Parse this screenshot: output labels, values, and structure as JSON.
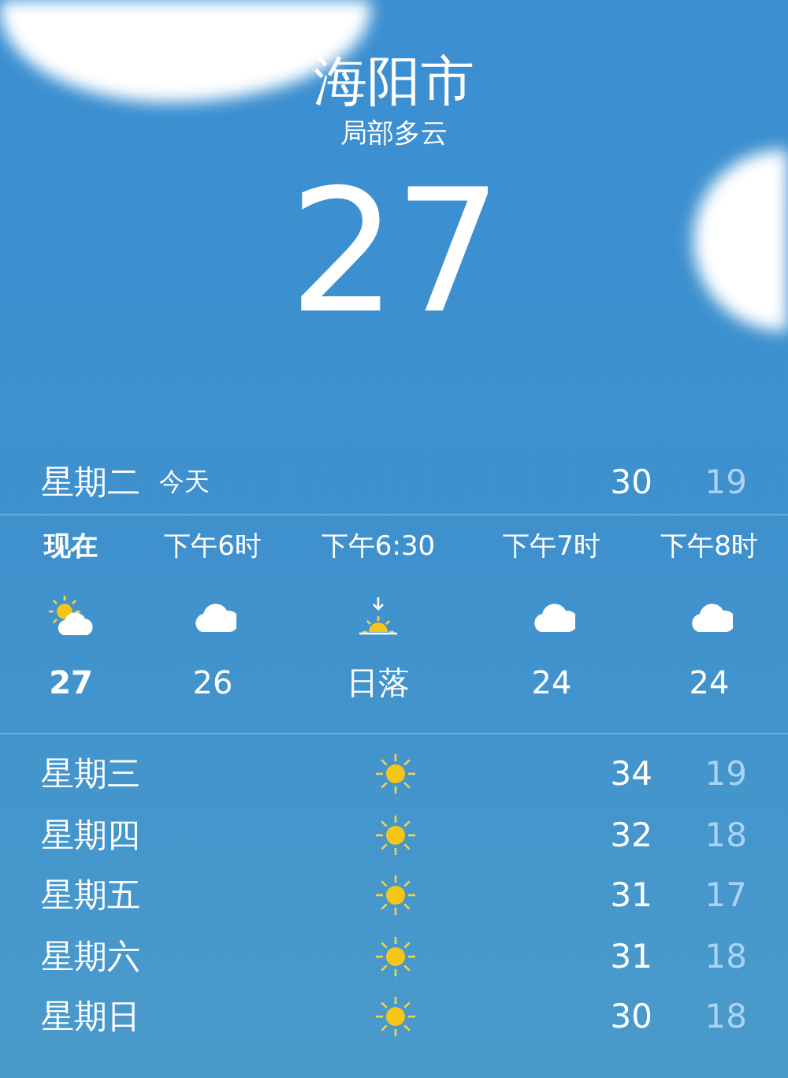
{
  "location": {
    "city": "海阳市",
    "condition": "局部多云",
    "temperature": "27"
  },
  "today": {
    "day": "星期二",
    "label": "今天",
    "high": "30",
    "low": "19"
  },
  "hourly": [
    {
      "time": "现在",
      "kind": "partly-sunny",
      "temp": "27",
      "current": true
    },
    {
      "time": "下午6时",
      "kind": "cloudy",
      "temp": "26",
      "current": false
    },
    {
      "time": "下午6:30",
      "kind": "sunset",
      "temp": "日落",
      "current": false
    },
    {
      "time": "下午7时",
      "kind": "cloudy",
      "temp": "24",
      "current": false
    },
    {
      "time": "下午8时",
      "kind": "cloudy",
      "temp": "24",
      "current": false
    }
  ],
  "daily": [
    {
      "day": "星期三",
      "kind": "sunny",
      "high": "34",
      "low": "19"
    },
    {
      "day": "星期四",
      "kind": "sunny",
      "high": "32",
      "low": "18"
    },
    {
      "day": "星期五",
      "kind": "sunny",
      "high": "31",
      "low": "17"
    },
    {
      "day": "星期六",
      "kind": "sunny",
      "high": "31",
      "low": "18"
    },
    {
      "day": "星期日",
      "kind": "sunny",
      "high": "30",
      "low": "18"
    }
  ]
}
